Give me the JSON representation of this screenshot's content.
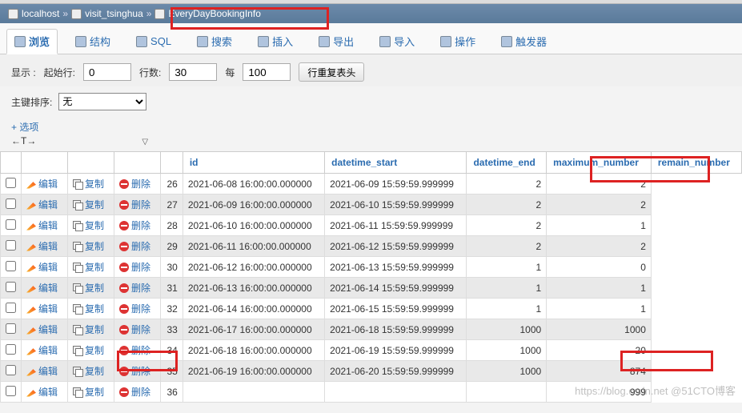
{
  "breadcrumb": {
    "server": "localhost",
    "db": "visit_tsinghua",
    "table": "EveryDayBookingInfo"
  },
  "tabs": [
    {
      "key": "browse",
      "label": "浏览",
      "active": true
    },
    {
      "key": "structure",
      "label": "结构"
    },
    {
      "key": "sql",
      "label": "SQL"
    },
    {
      "key": "search",
      "label": "搜索"
    },
    {
      "key": "insert",
      "label": "插入"
    },
    {
      "key": "export",
      "label": "导出"
    },
    {
      "key": "import",
      "label": "导入"
    },
    {
      "key": "operations",
      "label": "操作"
    },
    {
      "key": "triggers",
      "label": "触发器"
    }
  ],
  "controls": {
    "show_label": "显示 :",
    "start_label": "起始行:",
    "start_value": "0",
    "rowcount_label": "行数:",
    "rowcount_value": "30",
    "per_label": "每",
    "per_value": "100",
    "repeat_header_label": "行重复表头"
  },
  "pk_row": {
    "label": "主键排序:",
    "selected": "无"
  },
  "options_link": "+ 选项",
  "columns": [
    "",
    "",
    "",
    "",
    "",
    "id",
    "datetime_start",
    "datetime_end",
    "maximum_number",
    "remain_number"
  ],
  "row_actions": {
    "edit": "编辑",
    "copy": "复制",
    "delete": "删除"
  },
  "rows": [
    {
      "id": 26,
      "datetime_start": "2021-06-08 16:00:00.000000",
      "datetime_end": "2021-06-09 15:59:59.999999",
      "maximum_number": 2,
      "remain_number": 2
    },
    {
      "id": 27,
      "datetime_start": "2021-06-09 16:00:00.000000",
      "datetime_end": "2021-06-10 15:59:59.999999",
      "maximum_number": 2,
      "remain_number": 2
    },
    {
      "id": 28,
      "datetime_start": "2021-06-10 16:00:00.000000",
      "datetime_end": "2021-06-11 15:59:59.999999",
      "maximum_number": 2,
      "remain_number": 1
    },
    {
      "id": 29,
      "datetime_start": "2021-06-11 16:00:00.000000",
      "datetime_end": "2021-06-12 15:59:59.999999",
      "maximum_number": 2,
      "remain_number": 2
    },
    {
      "id": 30,
      "datetime_start": "2021-06-12 16:00:00.000000",
      "datetime_end": "2021-06-13 15:59:59.999999",
      "maximum_number": 1,
      "remain_number": 0
    },
    {
      "id": 31,
      "datetime_start": "2021-06-13 16:00:00.000000",
      "datetime_end": "2021-06-14 15:59:59.999999",
      "maximum_number": 1,
      "remain_number": 1
    },
    {
      "id": 32,
      "datetime_start": "2021-06-14 16:00:00.000000",
      "datetime_end": "2021-06-15 15:59:59.999999",
      "maximum_number": 1,
      "remain_number": 1
    },
    {
      "id": 33,
      "datetime_start": "2021-06-17 16:00:00.000000",
      "datetime_end": "2021-06-18 15:59:59.999999",
      "maximum_number": 1000,
      "remain_number": 1000
    },
    {
      "id": 34,
      "datetime_start": "2021-06-18 16:00:00.000000",
      "datetime_end": "2021-06-19 15:59:59.999999",
      "maximum_number": 1000,
      "remain_number": 20
    },
    {
      "id": 35,
      "datetime_start": "2021-06-19 16:00:00.000000",
      "datetime_end": "2021-06-20 15:59:59.999999",
      "maximum_number": 1000,
      "remain_number": 874
    },
    {
      "id": 36,
      "datetime_start": "",
      "datetime_end": "",
      "maximum_number": "",
      "remain_number": 999
    }
  ],
  "watermark": "https://blog.csdn.net @51CTO博客"
}
